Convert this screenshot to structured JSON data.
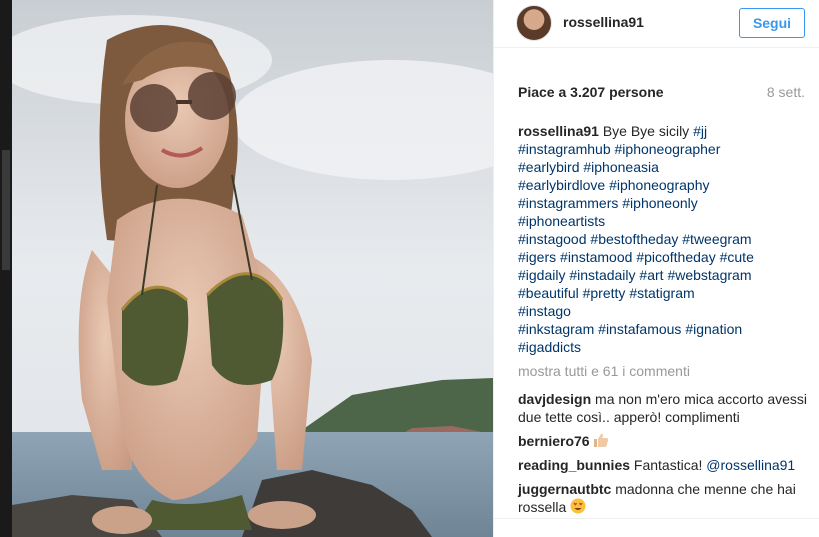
{
  "post": {
    "username": "rossellina91",
    "follow_label": "Segui",
    "likes_text": "Piace a 3.207 persone",
    "time_text": "8 sett."
  },
  "caption": {
    "username": "rossellina91",
    "text": "Bye Bye sicily",
    "lines": [
      [
        "#jj"
      ],
      [
        "#instagramhub",
        "#iphoneographer"
      ],
      [
        "#earlybird",
        "#iphoneasia"
      ],
      [
        "#earlybirdlove",
        "#iphoneography"
      ],
      [
        "#instagrammers",
        "#iphoneonly"
      ],
      [
        "#iphoneartists"
      ],
      [
        "#instagood",
        "#bestoftheday",
        "#tweegram"
      ],
      [
        "#igers",
        "#instamood",
        "#picoftheday",
        "#cute"
      ],
      [
        "#igdaily",
        "#instadaily",
        "#art",
        "#webstagram"
      ],
      [
        "#beautiful",
        "#pretty",
        "#statigram"
      ],
      [
        "#instago"
      ],
      [
        "#inkstagram",
        "#instafamous",
        "#ignation"
      ],
      [
        "#igaddicts"
      ]
    ]
  },
  "show_all_label": "mostra tutti e 61 i commenti",
  "comments": [
    {
      "user": "davjdesign",
      "text": "ma non m'ero mica accorto avessi due tette così.. apperò! complimenti",
      "emoji": ""
    },
    {
      "user": "berniero76",
      "text": "",
      "emoji": "thumbs-up-icon"
    },
    {
      "user": "reading_bunnies",
      "text": "Fantastica!",
      "mention": "@rossellina91",
      "emoji": ""
    },
    {
      "user": "juggernautbtc",
      "text": "madonna che menne che hai rossella",
      "emoji": "heart-eyes-icon"
    }
  ],
  "colors": {
    "link": "#003569",
    "accent": "#3897f0",
    "muted": "#999999"
  }
}
